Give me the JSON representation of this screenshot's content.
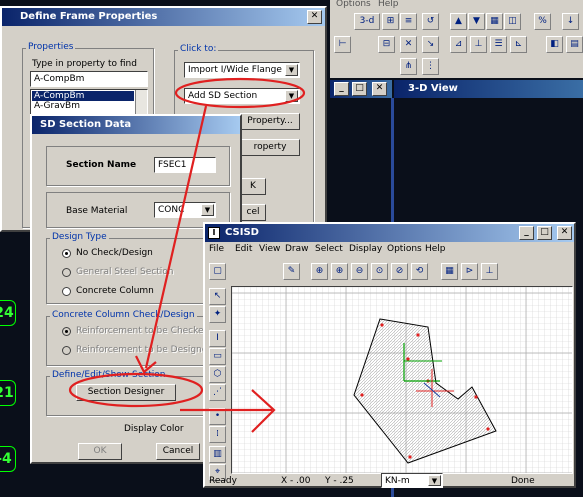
{
  "background_app": {
    "menu": [
      "Options",
      "Help"
    ],
    "view_title": "3-D View",
    "toolbar_text": "3-d",
    "node_labels": [
      "24",
      "21",
      "-4"
    ]
  },
  "define_frame": {
    "title": "Define Frame Properties",
    "properties_label": "Properties",
    "type_label": "Type in property to find",
    "find_value": "A-CompBm",
    "list_items": [
      "A-CompBm",
      "A-GravBm"
    ],
    "click_to_label": "Click to:",
    "import_value": "Import I/Wide Flange",
    "add_value": "Add SD Section",
    "modify_label": "Property...",
    "delete_label": "roperty",
    "ok_label": "K",
    "cancel_label": "cel"
  },
  "sd_section": {
    "title": "SD Section Data",
    "section_name_label": "Section Name",
    "section_name_value": "FSEC1",
    "base_material_label": "Base Material",
    "base_material_value": "CONC",
    "design_type_label": "Design Type",
    "design_options": [
      "No Check/Design",
      "General Steel Section",
      "Concrete Column"
    ],
    "column_check_label": "Concrete Column Check/Design",
    "column_options": [
      "Reinforcement to be Checked",
      "Reinforcement to be Designed"
    ],
    "define_edit_label": "Define/Edit/Show Section",
    "section_designer_label": "Section Designer",
    "display_color_label": "Display Color",
    "ok_label": "OK",
    "cancel_label": "Cancel"
  },
  "csisd": {
    "title": "CSISD",
    "menu": [
      "File",
      "Edit",
      "View",
      "Draw",
      "Select",
      "Display",
      "Options",
      "Help"
    ],
    "status_ready": "Ready",
    "status_x": "X - .00",
    "status_y": "Y - .25",
    "units": "KN-m",
    "status_done": "Done"
  },
  "colors": {
    "annotation": "#e02020",
    "title_bar": "#0a246a",
    "dialog_bg": "#d4d0c8",
    "grid": "#c8c8c8"
  }
}
